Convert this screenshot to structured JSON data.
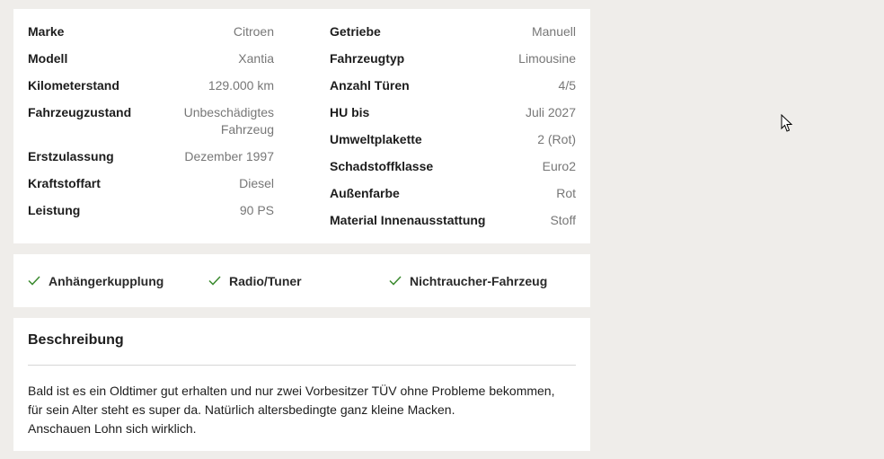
{
  "details": {
    "left": [
      {
        "label": "Marke",
        "value": "Citroen"
      },
      {
        "label": "Modell",
        "value": "Xantia"
      },
      {
        "label": "Kilometerstand",
        "value": "129.000 km"
      },
      {
        "label": "Fahrzeugzustand",
        "value": "Unbeschädigtes Fahrzeug"
      },
      {
        "label": "Erstzulassung",
        "value": "Dezember 1997"
      },
      {
        "label": "Kraftstoffart",
        "value": "Diesel"
      },
      {
        "label": "Leistung",
        "value": "90 PS"
      }
    ],
    "right": [
      {
        "label": "Getriebe",
        "value": "Manuell"
      },
      {
        "label": "Fahrzeugtyp",
        "value": "Limousine"
      },
      {
        "label": "Anzahl Türen",
        "value": "4/5"
      },
      {
        "label": "HU bis",
        "value": "Juli 2027"
      },
      {
        "label": "Umweltplakette",
        "value": "2 (Rot)"
      },
      {
        "label": "Schadstoffklasse",
        "value": "Euro2"
      },
      {
        "label": "Außenfarbe",
        "value": "Rot"
      },
      {
        "label": "Material Innenausstattung",
        "value": "Stoff"
      }
    ]
  },
  "features": [
    {
      "label": "Anhängerkupplung",
      "icon": "checkmark-icon"
    },
    {
      "label": "Radio/Tuner",
      "icon": "checkmark-icon"
    },
    {
      "label": "Nichtraucher-Fahrzeug",
      "icon": "checkmark-icon"
    }
  ],
  "description": {
    "title": "Beschreibung",
    "lines": [
      "Bald ist es ein Oldtimer gut erhalten und nur zwei Vorbesitzer TÜV ohne Probleme bekommen,",
      "für sein Alter steht es super da. Natürlich altersbedingte ganz kleine Macken.",
      "Anschauen Lohn sich wirklich."
    ]
  },
  "colors": {
    "background": "#efedea",
    "card": "#ffffff",
    "label": "#1d1d1d",
    "value": "#777777",
    "check": "#3a8a2e"
  }
}
